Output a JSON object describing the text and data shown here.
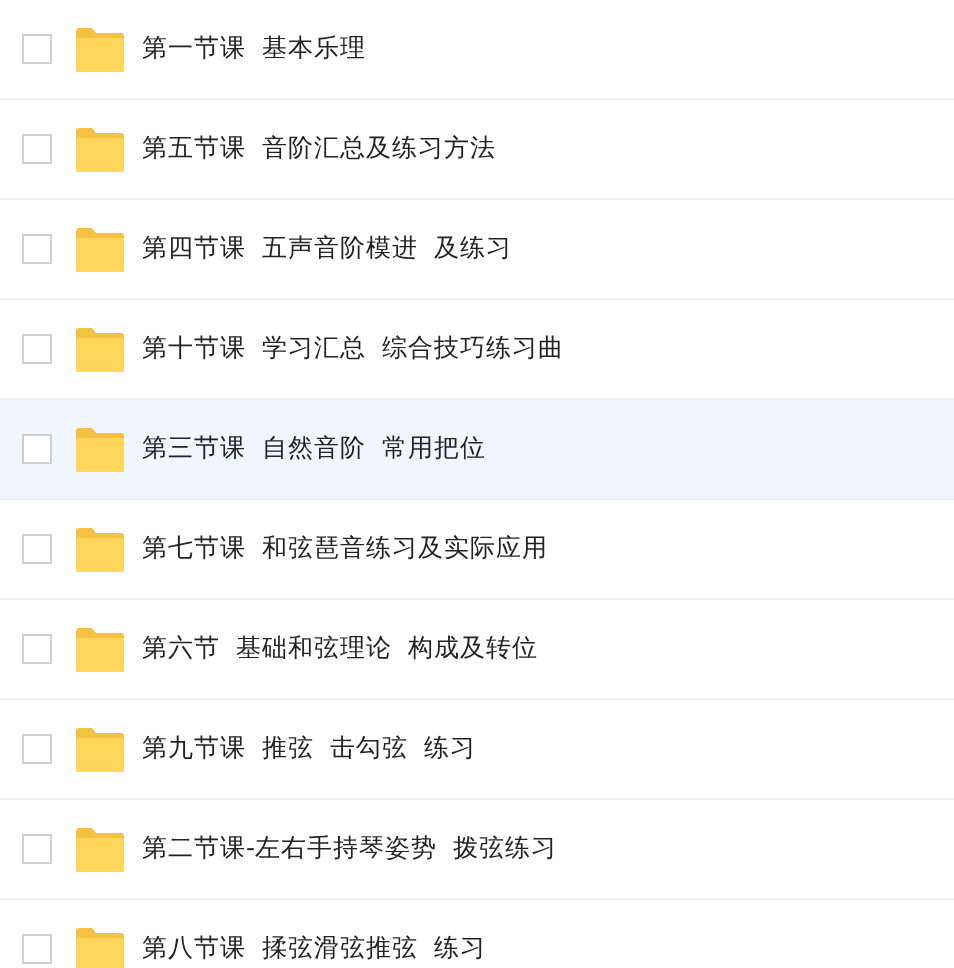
{
  "files": [
    {
      "name": "第一节课  基本乐理",
      "checked": false,
      "hovered": false
    },
    {
      "name": "第五节课  音阶汇总及练习方法",
      "checked": false,
      "hovered": false
    },
    {
      "name": "第四节课  五声音阶模进  及练习",
      "checked": false,
      "hovered": false
    },
    {
      "name": "第十节课  学习汇总  综合技巧练习曲",
      "checked": false,
      "hovered": false
    },
    {
      "name": "第三节课  自然音阶  常用把位",
      "checked": false,
      "hovered": true
    },
    {
      "name": "第七节课  和弦琶音练习及实际应用",
      "checked": false,
      "hovered": false
    },
    {
      "name": "第六节  基础和弦理论  构成及转位",
      "checked": false,
      "hovered": false
    },
    {
      "name": "第九节课  推弦  击勾弦  练习",
      "checked": false,
      "hovered": false
    },
    {
      "name": "第二节课-左右手持琴姿势  拨弦练习",
      "checked": false,
      "hovered": false
    },
    {
      "name": "第八节课  揉弦滑弦推弦  练习",
      "checked": false,
      "hovered": false
    }
  ]
}
